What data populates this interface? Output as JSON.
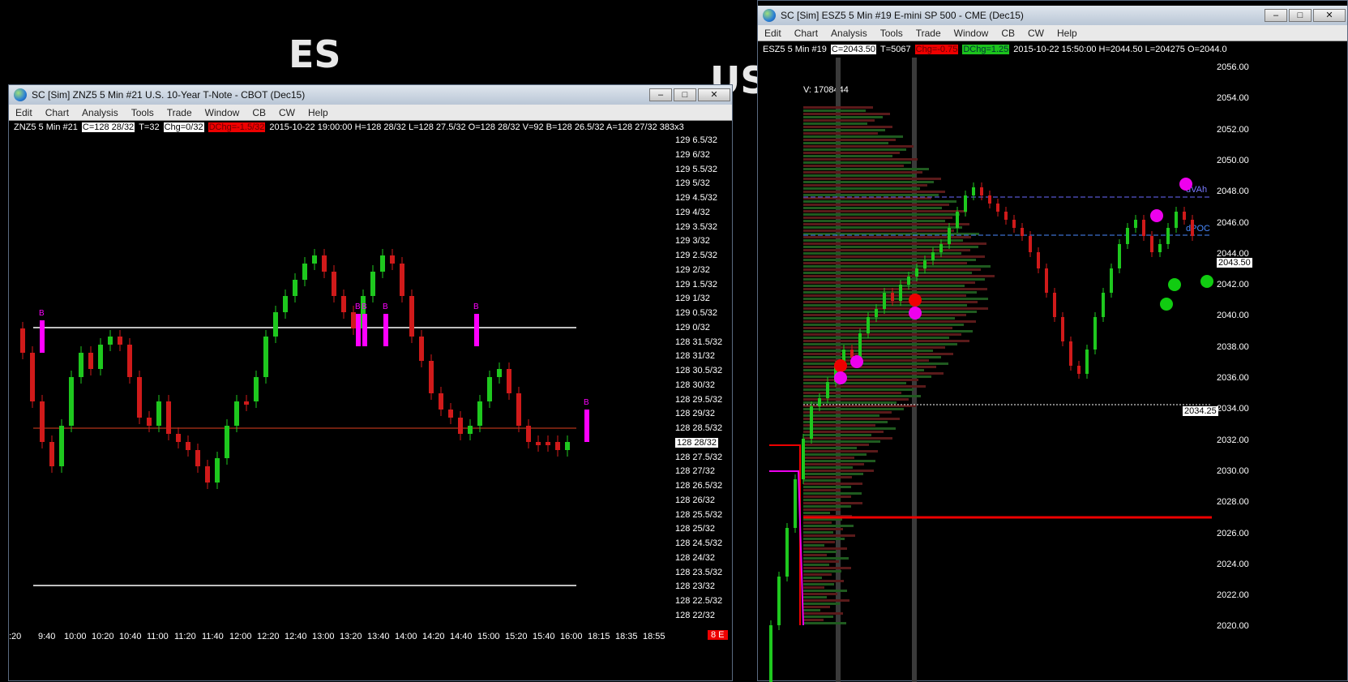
{
  "background": {
    "label_es": "ES",
    "label_us": "US"
  },
  "left_window": {
    "title": "SC [Sim] ZNZ5  5 Min   #21  U.S. 10-Year T-Note - CBOT (Dec15)",
    "buttons": {
      "minimize": "–",
      "maximize": "□",
      "close": "✕"
    },
    "menu": [
      "Edit",
      "Chart",
      "Analysis",
      "Tools",
      "Trade",
      "Window",
      "CB",
      "CW",
      "Help"
    ],
    "info": {
      "symbol": "ZNZ5  5 Min   #21",
      "close": "C=128 28/32",
      "trades": "T=32",
      "chg": "Chg=0/32",
      "dchg": "DChg=-1.5/32",
      "rest": "2015-10-22 19:00:00  H=128 28/32  L=128 27.5/32  O=128 28/32  V=92  B=128 26.5/32  A=128 27/32  383x3"
    },
    "price_labels": [
      "129 6.5/32",
      "129 6/32",
      "129 5.5/32",
      "129 5/32",
      "129 4.5/32",
      "129 4/32",
      "129 3.5/32",
      "129 3/32",
      "129 2.5/32",
      "129 2/32",
      "129 1.5/32",
      "129 1/32",
      "129 0.5/32",
      "129 0/32",
      "128 31.5/32",
      "128 31/32",
      "128 30.5/32",
      "128 30/32",
      "128 29.5/32",
      "128 29/32",
      "128 28.5/32",
      "128 28/32",
      "128 27.5/32",
      "128 27/32",
      "128 26.5/32",
      "128 26/32",
      "128 25.5/32",
      "128 25/32",
      "128 24.5/32",
      "128 24/32",
      "128 23.5/32",
      "128 23/32",
      "128 22.5/32",
      "128 22/32"
    ],
    "current_price_label": "128 28/32",
    "time_labels": [
      ":20",
      "9:40",
      "10:00",
      "10:20",
      "10:40",
      "11:00",
      "11:20",
      "11:40",
      "12:00",
      "12:20",
      "12:40",
      "13:00",
      "13:20",
      "13:40",
      "14:00",
      "14:20",
      "14:40",
      "15:00",
      "15:20",
      "15:40",
      "16:00",
      "18:15",
      "18:35",
      "18:55"
    ],
    "corner_badge": "8 E",
    "signal_letter": "B",
    "colors": {
      "up": "#1ec81e",
      "down": "#d01a1a",
      "signal": "#ff00ff"
    }
  },
  "right_window": {
    "title": "SC [Sim] ESZ5  5 Min   #19  E-mini SP 500 - CME (Dec15)",
    "buttons": {
      "minimize": "–",
      "maximize": "□",
      "close": "✕"
    },
    "menu": [
      "Edit",
      "Chart",
      "Analysis",
      "Tools",
      "Trade",
      "Window",
      "CB",
      "CW",
      "Help"
    ],
    "info": {
      "symbol": "ESZ5  5 Min   #19",
      "close": "C=2043.50",
      "trades": "T=5067",
      "chg": "Chg=-0.75",
      "dchg": "DChg=1.25",
      "rest": "2015-10-22 15:50:00  H=2044.50  L=204275  O=2044.0"
    },
    "volume_label": "V: 1708444",
    "price_labels": [
      "2056.00",
      "2054.00",
      "2052.00",
      "2050.00",
      "2048.00",
      "2046.00",
      "2044.00",
      "2042.00",
      "2040.00",
      "2038.00",
      "2036.00",
      "2034.00",
      "2032.00",
      "2030.00",
      "2028.00",
      "2026.00",
      "2024.00",
      "2022.00",
      "2020.00"
    ],
    "current_price_label": "2043.50",
    "level_label": "2034.25",
    "vah_label": "dVAh",
    "poc_label": "dPOC",
    "colors": {
      "up": "#1ec81e",
      "down": "#d01a1a",
      "profile_up": "#1f5a1f",
      "profile_down": "#5a1a1a"
    }
  }
}
